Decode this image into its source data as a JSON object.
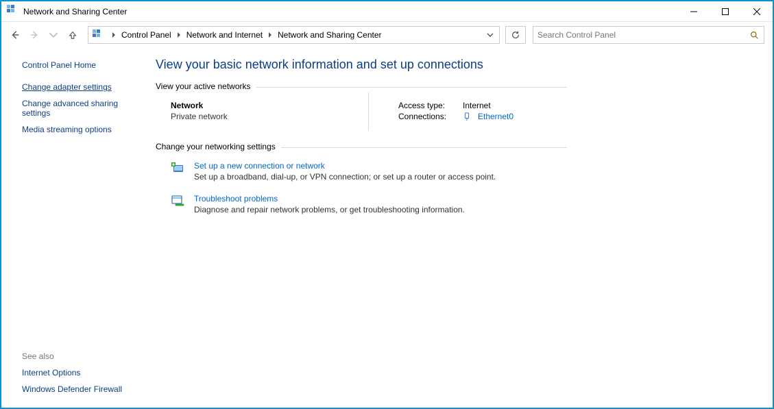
{
  "window": {
    "title": "Network and Sharing Center"
  },
  "breadcrumbs": {
    "0": "Control Panel",
    "1": "Network and Internet",
    "2": "Network and Sharing Center"
  },
  "search": {
    "placeholder": "Search Control Panel"
  },
  "sidebar": {
    "home": "Control Panel Home",
    "links": {
      "adapter": "Change adapter settings",
      "advanced": "Change advanced sharing settings",
      "media": "Media streaming options"
    },
    "seealso_head": "See also",
    "seealso": {
      "inetopt": "Internet Options",
      "firewall": "Windows Defender Firewall"
    }
  },
  "main": {
    "heading": "View your basic network information and set up connections",
    "active_label": "View your active networks",
    "network": {
      "name": "Network",
      "type": "Private network",
      "access_key": "Access type:",
      "access_val": "Internet",
      "conn_key": "Connections:",
      "conn_val": "Ethernet0"
    },
    "change_label": "Change your networking settings",
    "task1": {
      "title": "Set up a new connection or network",
      "desc": "Set up a broadband, dial-up, or VPN connection; or set up a router or access point."
    },
    "task2": {
      "title": "Troubleshoot problems",
      "desc": "Diagnose and repair network problems, or get troubleshooting information."
    }
  }
}
